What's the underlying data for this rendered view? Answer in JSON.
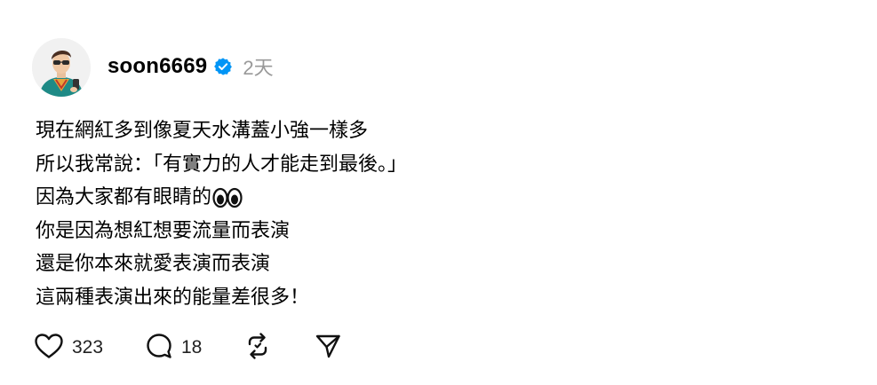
{
  "post": {
    "author": {
      "username": "soon6669",
      "verified": true,
      "avatar_icon": "avatar-photo-icon"
    },
    "timestamp": "2天",
    "lines": [
      "現在網紅多到像夏天水溝蓋小強一樣多",
      "所以我常說：「有實力的人才能走到最後。」",
      "因為大家都有眼睛的",
      "你是因為想紅想要流量而表演",
      "還是你本來就愛表演而表演",
      "這兩種表演出來的能量差很多！"
    ],
    "inline_emoji": "eyes-emoji-icon",
    "actions": {
      "like": {
        "icon": "heart-icon",
        "count": "323"
      },
      "reply": {
        "icon": "comment-icon",
        "count": "18"
      },
      "repost": {
        "icon": "repost-icon"
      },
      "share": {
        "icon": "send-icon"
      }
    },
    "colors": {
      "verified_badge": "#0095F6",
      "timestamp": "#999999",
      "text": "#000000"
    }
  }
}
